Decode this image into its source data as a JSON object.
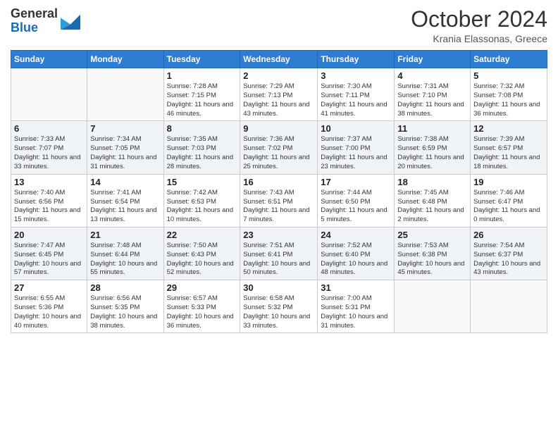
{
  "header": {
    "logo_general": "General",
    "logo_blue": "Blue",
    "month_year": "October 2024",
    "location": "Krania Elassonas, Greece"
  },
  "days_of_week": [
    "Sunday",
    "Monday",
    "Tuesday",
    "Wednesday",
    "Thursday",
    "Friday",
    "Saturday"
  ],
  "weeks": [
    [
      {
        "day": "",
        "sunrise": "",
        "sunset": "",
        "daylight": ""
      },
      {
        "day": "",
        "sunrise": "",
        "sunset": "",
        "daylight": ""
      },
      {
        "day": "1",
        "sunrise": "Sunrise: 7:28 AM",
        "sunset": "Sunset: 7:15 PM",
        "daylight": "Daylight: 11 hours and 46 minutes."
      },
      {
        "day": "2",
        "sunrise": "Sunrise: 7:29 AM",
        "sunset": "Sunset: 7:13 PM",
        "daylight": "Daylight: 11 hours and 43 minutes."
      },
      {
        "day": "3",
        "sunrise": "Sunrise: 7:30 AM",
        "sunset": "Sunset: 7:11 PM",
        "daylight": "Daylight: 11 hours and 41 minutes."
      },
      {
        "day": "4",
        "sunrise": "Sunrise: 7:31 AM",
        "sunset": "Sunset: 7:10 PM",
        "daylight": "Daylight: 11 hours and 38 minutes."
      },
      {
        "day": "5",
        "sunrise": "Sunrise: 7:32 AM",
        "sunset": "Sunset: 7:08 PM",
        "daylight": "Daylight: 11 hours and 36 minutes."
      }
    ],
    [
      {
        "day": "6",
        "sunrise": "Sunrise: 7:33 AM",
        "sunset": "Sunset: 7:07 PM",
        "daylight": "Daylight: 11 hours and 33 minutes."
      },
      {
        "day": "7",
        "sunrise": "Sunrise: 7:34 AM",
        "sunset": "Sunset: 7:05 PM",
        "daylight": "Daylight: 11 hours and 31 minutes."
      },
      {
        "day": "8",
        "sunrise": "Sunrise: 7:35 AM",
        "sunset": "Sunset: 7:03 PM",
        "daylight": "Daylight: 11 hours and 28 minutes."
      },
      {
        "day": "9",
        "sunrise": "Sunrise: 7:36 AM",
        "sunset": "Sunset: 7:02 PM",
        "daylight": "Daylight: 11 hours and 25 minutes."
      },
      {
        "day": "10",
        "sunrise": "Sunrise: 7:37 AM",
        "sunset": "Sunset: 7:00 PM",
        "daylight": "Daylight: 11 hours and 23 minutes."
      },
      {
        "day": "11",
        "sunrise": "Sunrise: 7:38 AM",
        "sunset": "Sunset: 6:59 PM",
        "daylight": "Daylight: 11 hours and 20 minutes."
      },
      {
        "day": "12",
        "sunrise": "Sunrise: 7:39 AM",
        "sunset": "Sunset: 6:57 PM",
        "daylight": "Daylight: 11 hours and 18 minutes."
      }
    ],
    [
      {
        "day": "13",
        "sunrise": "Sunrise: 7:40 AM",
        "sunset": "Sunset: 6:56 PM",
        "daylight": "Daylight: 11 hours and 15 minutes."
      },
      {
        "day": "14",
        "sunrise": "Sunrise: 7:41 AM",
        "sunset": "Sunset: 6:54 PM",
        "daylight": "Daylight: 11 hours and 13 minutes."
      },
      {
        "day": "15",
        "sunrise": "Sunrise: 7:42 AM",
        "sunset": "Sunset: 6:53 PM",
        "daylight": "Daylight: 11 hours and 10 minutes."
      },
      {
        "day": "16",
        "sunrise": "Sunrise: 7:43 AM",
        "sunset": "Sunset: 6:51 PM",
        "daylight": "Daylight: 11 hours and 7 minutes."
      },
      {
        "day": "17",
        "sunrise": "Sunrise: 7:44 AM",
        "sunset": "Sunset: 6:50 PM",
        "daylight": "Daylight: 11 hours and 5 minutes."
      },
      {
        "day": "18",
        "sunrise": "Sunrise: 7:45 AM",
        "sunset": "Sunset: 6:48 PM",
        "daylight": "Daylight: 11 hours and 2 minutes."
      },
      {
        "day": "19",
        "sunrise": "Sunrise: 7:46 AM",
        "sunset": "Sunset: 6:47 PM",
        "daylight": "Daylight: 11 hours and 0 minutes."
      }
    ],
    [
      {
        "day": "20",
        "sunrise": "Sunrise: 7:47 AM",
        "sunset": "Sunset: 6:45 PM",
        "daylight": "Daylight: 10 hours and 57 minutes."
      },
      {
        "day": "21",
        "sunrise": "Sunrise: 7:48 AM",
        "sunset": "Sunset: 6:44 PM",
        "daylight": "Daylight: 10 hours and 55 minutes."
      },
      {
        "day": "22",
        "sunrise": "Sunrise: 7:50 AM",
        "sunset": "Sunset: 6:43 PM",
        "daylight": "Daylight: 10 hours and 52 minutes."
      },
      {
        "day": "23",
        "sunrise": "Sunrise: 7:51 AM",
        "sunset": "Sunset: 6:41 PM",
        "daylight": "Daylight: 10 hours and 50 minutes."
      },
      {
        "day": "24",
        "sunrise": "Sunrise: 7:52 AM",
        "sunset": "Sunset: 6:40 PM",
        "daylight": "Daylight: 10 hours and 48 minutes."
      },
      {
        "day": "25",
        "sunrise": "Sunrise: 7:53 AM",
        "sunset": "Sunset: 6:38 PM",
        "daylight": "Daylight: 10 hours and 45 minutes."
      },
      {
        "day": "26",
        "sunrise": "Sunrise: 7:54 AM",
        "sunset": "Sunset: 6:37 PM",
        "daylight": "Daylight: 10 hours and 43 minutes."
      }
    ],
    [
      {
        "day": "27",
        "sunrise": "Sunrise: 6:55 AM",
        "sunset": "Sunset: 5:36 PM",
        "daylight": "Daylight: 10 hours and 40 minutes."
      },
      {
        "day": "28",
        "sunrise": "Sunrise: 6:56 AM",
        "sunset": "Sunset: 5:35 PM",
        "daylight": "Daylight: 10 hours and 38 minutes."
      },
      {
        "day": "29",
        "sunrise": "Sunrise: 6:57 AM",
        "sunset": "Sunset: 5:33 PM",
        "daylight": "Daylight: 10 hours and 36 minutes."
      },
      {
        "day": "30",
        "sunrise": "Sunrise: 6:58 AM",
        "sunset": "Sunset: 5:32 PM",
        "daylight": "Daylight: 10 hours and 33 minutes."
      },
      {
        "day": "31",
        "sunrise": "Sunrise: 7:00 AM",
        "sunset": "Sunset: 5:31 PM",
        "daylight": "Daylight: 10 hours and 31 minutes."
      },
      {
        "day": "",
        "sunrise": "",
        "sunset": "",
        "daylight": ""
      },
      {
        "day": "",
        "sunrise": "",
        "sunset": "",
        "daylight": ""
      }
    ]
  ]
}
